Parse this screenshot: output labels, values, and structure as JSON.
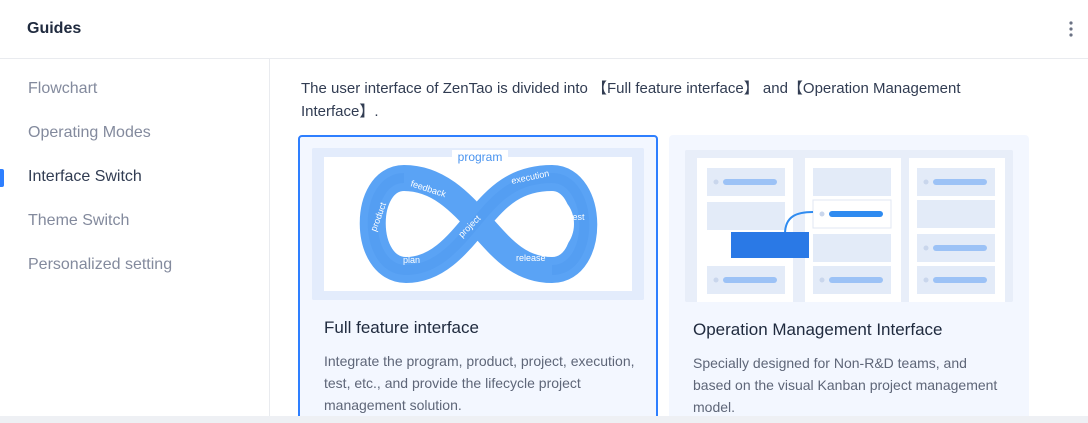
{
  "header": {
    "title": "Guides",
    "more_icon": "more-vertical-icon"
  },
  "sidebar": {
    "items": [
      {
        "label": "Flowchart",
        "active": false
      },
      {
        "label": "Operating Modes",
        "active": false
      },
      {
        "label": "Interface Switch",
        "active": true
      },
      {
        "label": "Theme Switch",
        "active": false
      },
      {
        "label": "Personalized setting",
        "active": false
      }
    ]
  },
  "main": {
    "intro": "The user interface of ZenTao is divided into 【Full feature interface】 and【Operation Management Interface】.",
    "cards": [
      {
        "title": "Full feature interface",
        "description": "Integrate the program, product, project, execution, test, etc., and provide the lifecycle project management solution.",
        "selected": true,
        "diagram_labels": {
          "program": "program",
          "feedback": "feedback",
          "execution": "execution",
          "product": "product",
          "project": "project",
          "test": "test",
          "plan": "plan",
          "release": "release"
        }
      },
      {
        "title": "Operation Management Interface",
        "description": "Specially designed for Non-R&D teams, and based on the visual Kanban project management model.",
        "selected": false
      }
    ]
  },
  "colors": {
    "accent": "#2e7fff",
    "card_bg": "#f3f7ff",
    "loop_blue": "#4d9bf5"
  }
}
